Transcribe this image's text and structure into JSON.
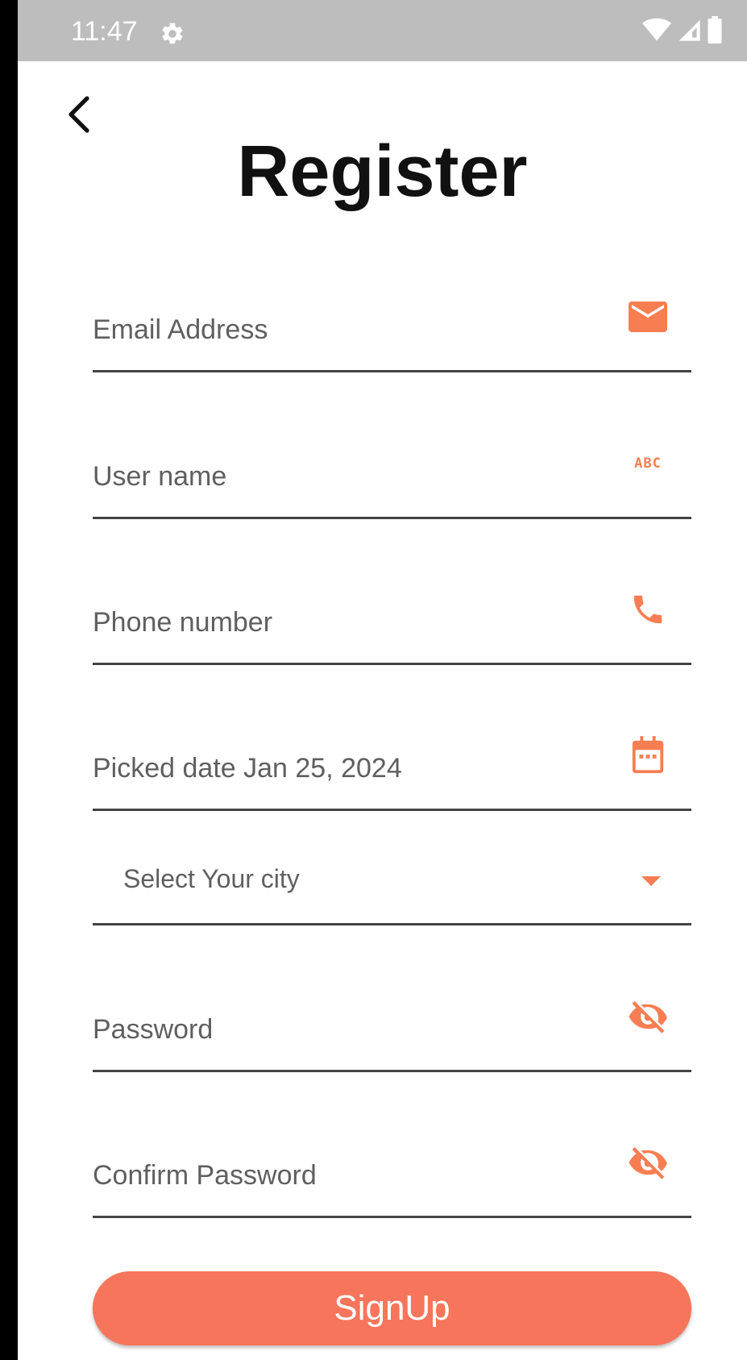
{
  "status_bar": {
    "time": "11:47",
    "gear_icon": "settings-icon",
    "right_icons": [
      "wifi-icon",
      "signal-icon",
      "battery-icon"
    ]
  },
  "header": {
    "back_icon": "chevron-left-icon",
    "title": "Register"
  },
  "form": {
    "email": {
      "placeholder": "Email Address",
      "icon": "mail-icon"
    },
    "username": {
      "placeholder": "User name",
      "icon": "abc-icon",
      "icon_text": "ABC"
    },
    "phone": {
      "placeholder": "Phone number",
      "icon": "phone-icon"
    },
    "date": {
      "text": "Picked date Jan 25, 2024",
      "icon": "calendar-icon"
    },
    "city": {
      "selected": "Select Your city",
      "icon": "dropdown-arrow-icon"
    },
    "password": {
      "placeholder": "Password",
      "icon": "eye-off-icon"
    },
    "confirm_password": {
      "placeholder": "Confirm Password",
      "icon": "eye-off-icon"
    }
  },
  "signup_button": {
    "label": "SignUp"
  },
  "colors": {
    "accent": "#f77e52",
    "button": "#f7755a",
    "status_bar": "#bdbdbd"
  }
}
